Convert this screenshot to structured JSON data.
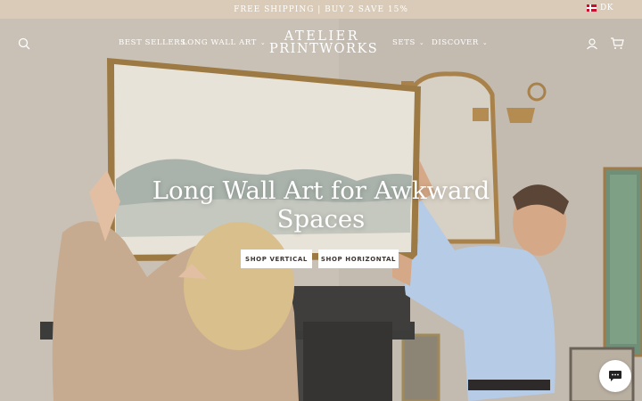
{
  "announcement": {
    "text": "FREE SHIPPING | BUY 2 SAVE 15%",
    "locale": "DK",
    "flag_icon": "denmark-flag-icon"
  },
  "header": {
    "logo_line1": "ATELIER",
    "logo_line2": "PRINTWORKS",
    "nav": [
      {
        "label": "BEST SELLERS",
        "has_dropdown": false
      },
      {
        "label": "LONG WALL ART",
        "has_dropdown": true
      },
      {
        "label": "SETS",
        "has_dropdown": true
      },
      {
        "label": "DISCOVER",
        "has_dropdown": true
      }
    ],
    "icons": [
      "search-icon",
      "account-icon",
      "cart-icon"
    ]
  },
  "hero": {
    "headline": "Long Wall Art for Awkward Spaces",
    "buttons": [
      {
        "label": "SHOP VERTICAL"
      },
      {
        "label": "SHOP HORIZONTAL"
      }
    ]
  },
  "chat": {
    "icon": "chat-bubble-icon"
  },
  "colors": {
    "announcement_bg": "#d9cbb7",
    "cta_bg": "#ffffff",
    "text_on_image": "#ffffff"
  }
}
